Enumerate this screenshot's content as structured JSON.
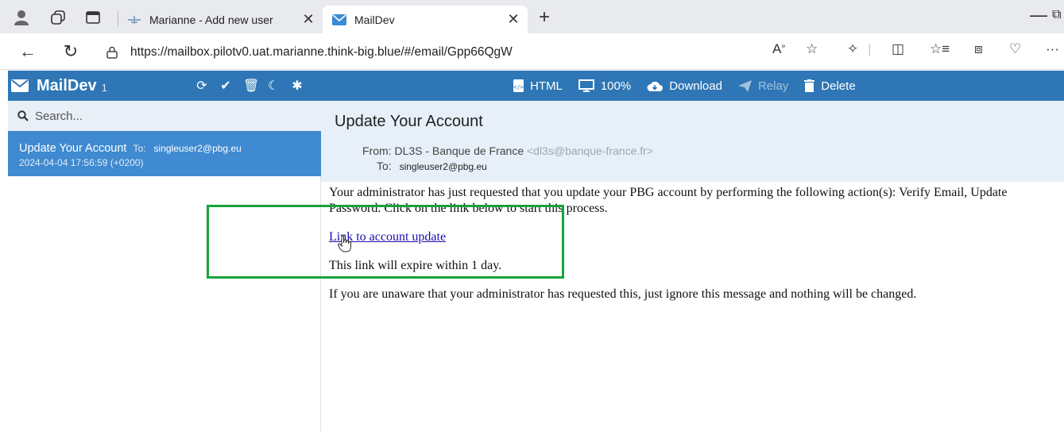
{
  "browser": {
    "tabs": [
      {
        "title": "Marianne - Add new user",
        "active": false
      },
      {
        "title": "MailDev",
        "active": true
      }
    ],
    "url": "https://mailbox.pilotv0.uat.marianne.think-big.blue/#/email/Gpp66QgW"
  },
  "maildev": {
    "app_name": "MailDev",
    "count": "1",
    "actions": {
      "html": "HTML",
      "zoom": "100%",
      "download": "Download",
      "relay": "Relay",
      "delete": "Delete"
    }
  },
  "sidebar": {
    "search_placeholder": "Search...",
    "emails": [
      {
        "subject": "Update Your Account",
        "to_label": "To:",
        "to": "singleuser2@pbg.eu",
        "date": "2024-04-04 17:56:59 (+0200)"
      }
    ]
  },
  "email": {
    "subject": "Update Your Account",
    "from_label": "From:",
    "from_name": "DL3S - Banque de France",
    "from_address": "<dl3s@banque-france.fr>",
    "to_label": "To:",
    "to": "singleuser2@pbg.eu",
    "body": {
      "paragraph1": "Your administrator has just requested that you update your PBG account by performing the following action(s): Verify Email, Update Password. Click on the link below to start this process.",
      "link": "Link to account update",
      "expire": "This link will expire within 1 day.",
      "paragraph3": "If you are unaware that your administrator has requested this, just ignore this message and nothing will be changed."
    }
  },
  "colors": {
    "maildev_header": "#2e76b5",
    "selected_item": "#3f8ad0",
    "highlight_box": "#18a33a"
  }
}
